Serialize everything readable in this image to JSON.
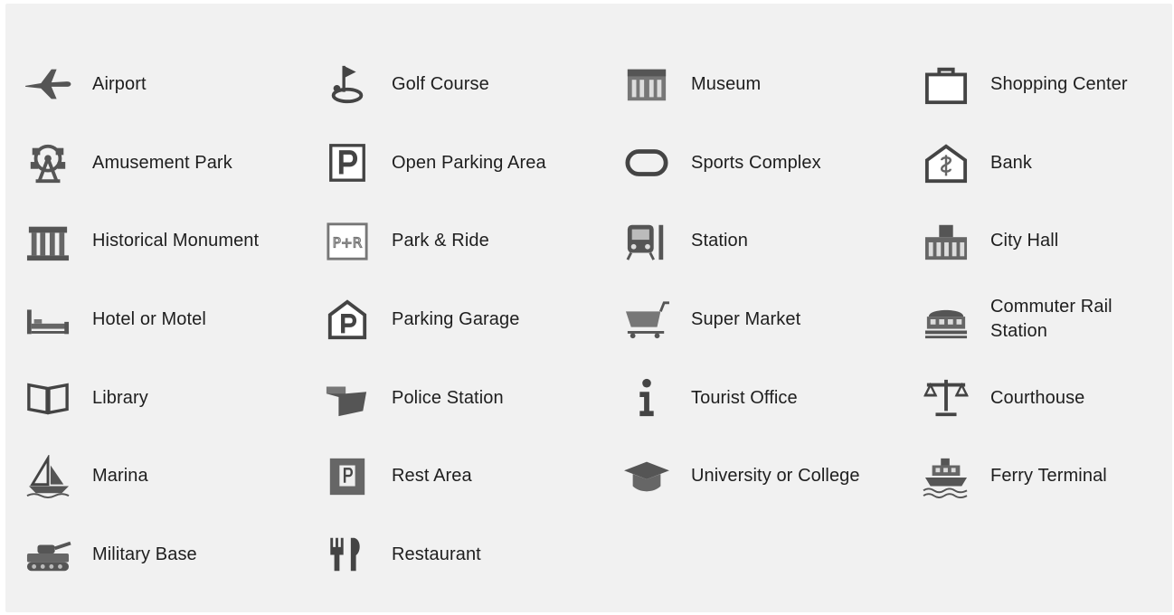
{
  "legend": {
    "col1": [
      "Airport",
      "Amusement Park",
      "Historical Monument",
      "Hotel or Motel",
      "Library",
      "Marina",
      "Military Base"
    ],
    "col2": [
      "Golf Course",
      "Open Parking Area",
      "Park & Ride",
      "Parking Garage",
      "Police Station",
      "Rest Area",
      "Restaurant"
    ],
    "col3": [
      "Museum",
      "Sports Complex",
      "Station",
      "Super Market",
      "Tourist Office",
      "University or College"
    ],
    "col4": [
      "Shopping Center",
      "Bank",
      "City Hall",
      "Commuter Rail Station",
      "Courthouse",
      "Ferry Terminal"
    ]
  },
  "icons": {
    "col1": [
      "airplane-icon",
      "ferris-wheel-icon",
      "columns-icon",
      "bed-icon",
      "open-book-icon",
      "sailboat-icon",
      "tank-icon"
    ],
    "col2": [
      "golf-flag-icon",
      "parking-p-icon",
      "park-and-ride-icon",
      "parking-garage-icon",
      "police-badge-icon",
      "rest-area-icon",
      "fork-knife-icon"
    ],
    "col3": [
      "museum-building-icon",
      "stadium-ring-icon",
      "train-front-icon",
      "shopping-cart-icon",
      "info-i-icon",
      "mortarboard-icon"
    ],
    "col4": [
      "shopping-bag-icon",
      "bank-icon",
      "city-hall-icon",
      "commuter-train-icon",
      "scales-icon",
      "ferry-icon"
    ]
  }
}
